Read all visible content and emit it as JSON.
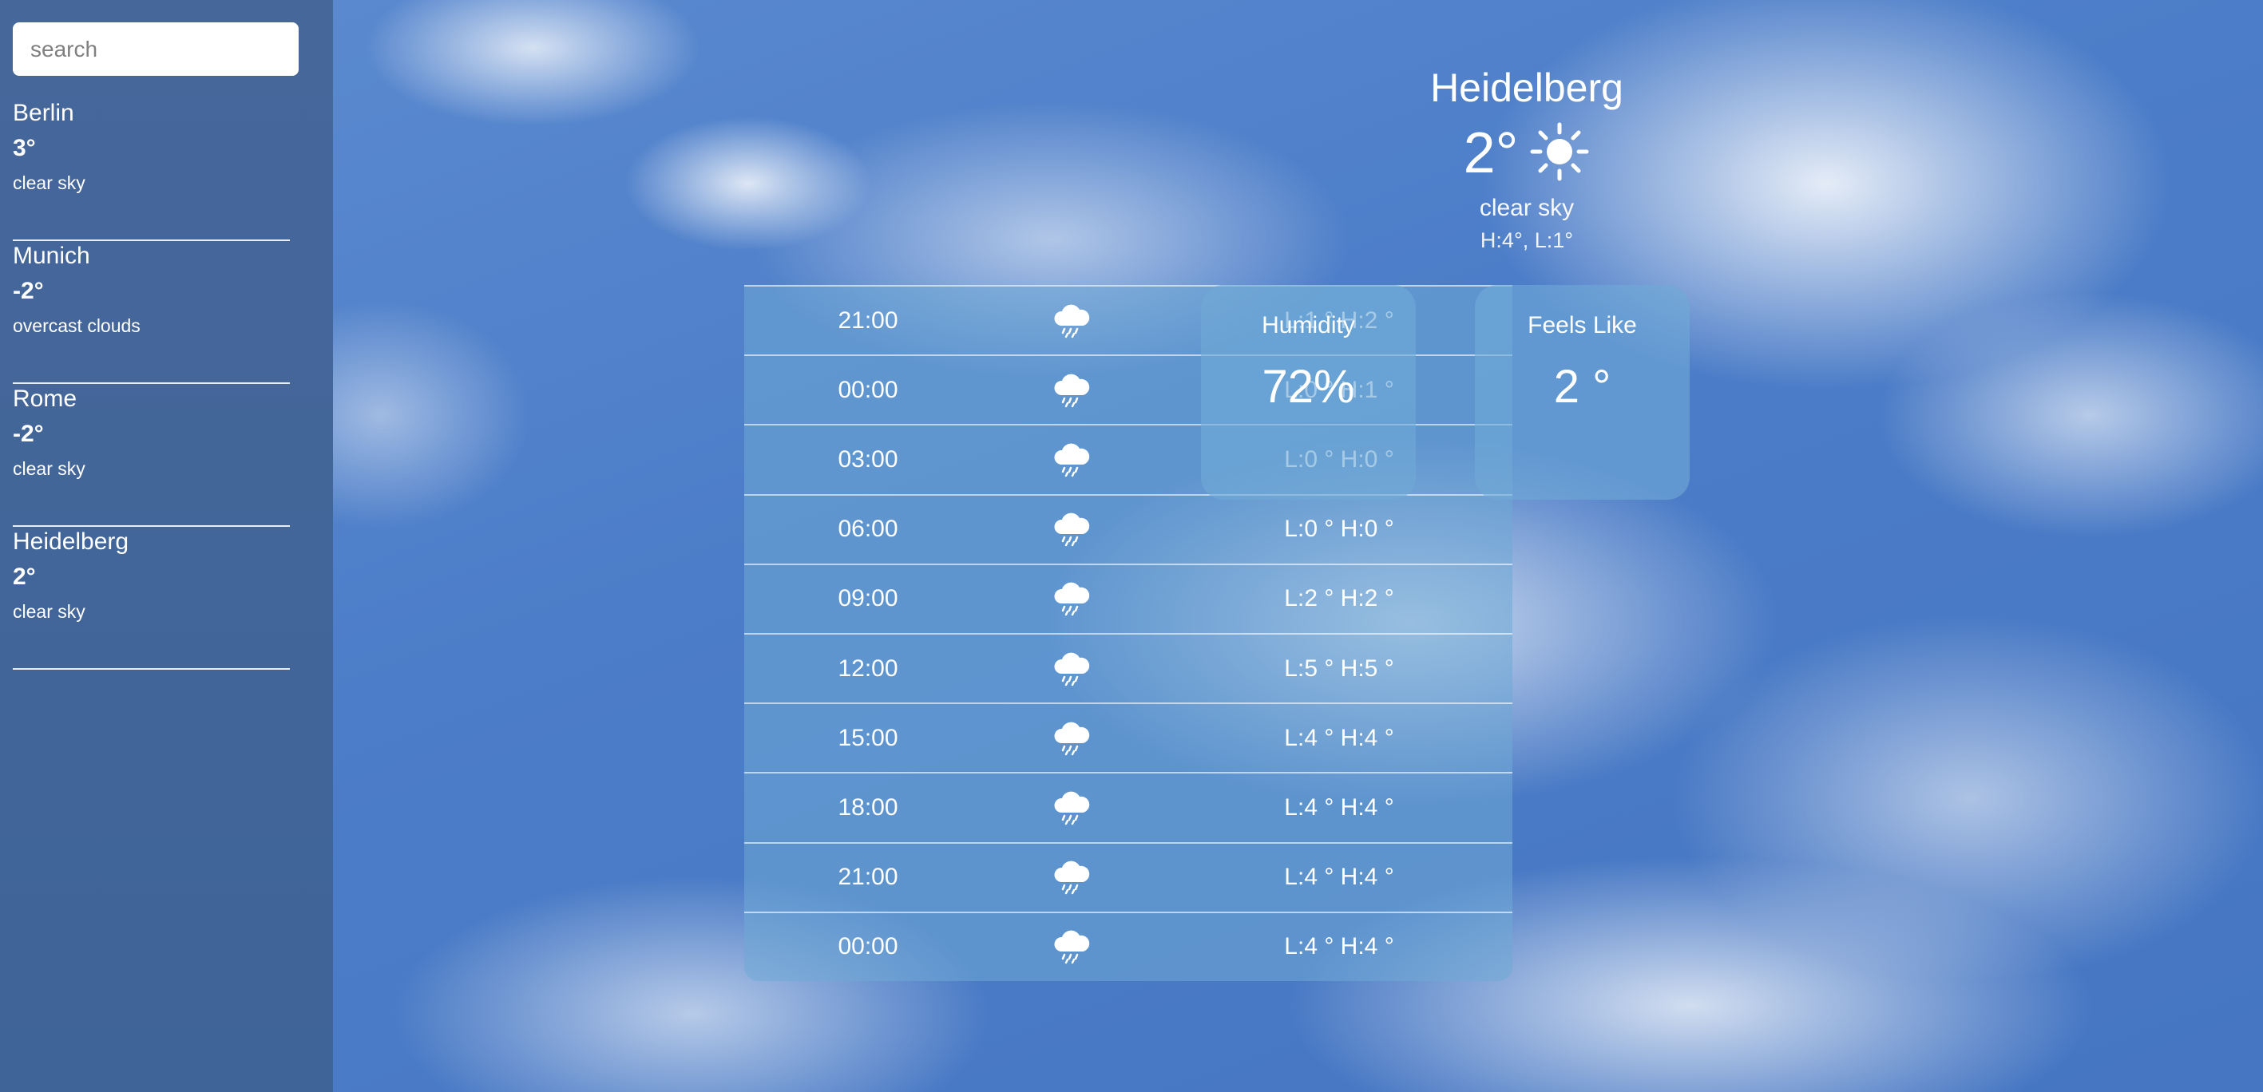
{
  "search": {
    "placeholder": "search",
    "value": ""
  },
  "cities": [
    {
      "name": "Berlin",
      "temp": "3°",
      "desc": "clear sky"
    },
    {
      "name": "Munich",
      "temp": "-2°",
      "desc": "overcast clouds"
    },
    {
      "name": "Rome",
      "temp": "-2°",
      "desc": "clear sky"
    },
    {
      "name": "Heidelberg",
      "temp": "2°",
      "desc": "clear sky"
    }
  ],
  "current": {
    "city": "Heidelberg",
    "temp": "2°",
    "icon": "sun-icon",
    "desc": "clear sky",
    "high_low": "H:4°, L:1°"
  },
  "forecast": [
    {
      "time": "21:00",
      "icon": "rain-cloud-icon",
      "range": "L:1 ° H:2 °"
    },
    {
      "time": "00:00",
      "icon": "rain-cloud-icon",
      "range": "L:0 ° H:1 °"
    },
    {
      "time": "03:00",
      "icon": "rain-cloud-icon",
      "range": "L:0 ° H:0 °"
    },
    {
      "time": "06:00",
      "icon": "rain-cloud-icon",
      "range": "L:0 ° H:0 °"
    },
    {
      "time": "09:00",
      "icon": "rain-cloud-icon",
      "range": "L:2 ° H:2 °"
    },
    {
      "time": "12:00",
      "icon": "rain-cloud-icon",
      "range": "L:5 ° H:5 °"
    },
    {
      "time": "15:00",
      "icon": "rain-cloud-icon",
      "range": "L:4 ° H:4 °"
    },
    {
      "time": "18:00",
      "icon": "rain-cloud-icon",
      "range": "L:4 ° H:4 °"
    },
    {
      "time": "21:00",
      "icon": "rain-cloud-icon",
      "range": "L:4 ° H:4 °"
    },
    {
      "time": "00:00",
      "icon": "rain-cloud-icon",
      "range": "L:4 ° H:4 °"
    }
  ],
  "humidity": {
    "label": "Humidity",
    "value": "72%"
  },
  "feels_like": {
    "label": "Feels Like",
    "value": "2 °"
  },
  "colors": {
    "sidebar": "#3f6498",
    "sky": "#4a78c2",
    "panel": "#70aad6"
  }
}
